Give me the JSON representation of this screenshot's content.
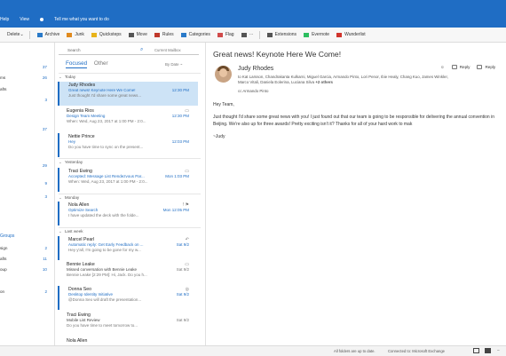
{
  "topbar": {
    "items": [
      "Help",
      "View",
      "Tell me what you want to do"
    ]
  },
  "toolbar": {
    "items": [
      {
        "label": "Delete",
        "icon": "chevron-down-icon",
        "color": "#333333"
      },
      {
        "label": "Archive",
        "icon": "archive-icon",
        "color": "#2a7ac9"
      },
      {
        "label": "Junk",
        "icon": "junk-icon",
        "color": "#e08a1e"
      },
      {
        "label": "Quicksteps",
        "icon": "lightning-icon",
        "color": "#e8b31a"
      },
      {
        "label": "Move",
        "icon": "move-icon",
        "color": "#555555"
      },
      {
        "label": "Rules",
        "icon": "rules-icon",
        "color": "#c0392b"
      },
      {
        "label": "Categories",
        "icon": "categories-icon",
        "color": "#2a7ac9"
      },
      {
        "label": "Flag",
        "icon": "flag-icon",
        "color": "#d04b4b"
      },
      {
        "label": "···",
        "icon": "more-icon",
        "color": "#555555"
      },
      {
        "label": "Extensions",
        "icon": "extensions-icon",
        "color": "#555555"
      },
      {
        "label": "Evernote",
        "icon": "evernote-icon",
        "color": "#2dbe60"
      },
      {
        "label": "Wunderlist",
        "icon": "wunderlist-icon",
        "color": "#d0342c"
      }
    ]
  },
  "left": {
    "rows": [
      {
        "label": "",
        "count": "37"
      },
      {
        "label": "ms",
        "count": "26"
      },
      {
        "label": "afts",
        "count": ""
      },
      {
        "label": "",
        "count": "3"
      },
      {
        "label": "",
        "count": "37"
      },
      {
        "label": "",
        "count": "29"
      },
      {
        "label": "",
        "count": "9"
      },
      {
        "label": "",
        "count": "3"
      }
    ],
    "groups_label": "Groups",
    "group_rows": [
      {
        "label": "sign",
        "count": "2"
      },
      {
        "label": "afts",
        "count": "11"
      },
      {
        "label": "oup",
        "count": "10"
      },
      {
        "label": "on",
        "count": "2"
      }
    ]
  },
  "list": {
    "search_placeholder": "Search",
    "search_scope": "Current Mailbox",
    "tab_focused": "Focused",
    "tab_other": "Other",
    "sort": "By Date ~",
    "groups": [
      {
        "label": "Today"
      },
      {
        "label": "Yesterday"
      },
      {
        "label": "Monday"
      },
      {
        "label": "Last week"
      }
    ],
    "messages": [
      {
        "from": "Judy Rhodes",
        "subject": "Great news! Keynote Here We Come!",
        "preview": "Just thought I'd share some great news...",
        "date": "12:30 PM",
        "icon": ""
      },
      {
        "from": "Eugenia Rios",
        "subject": "Design Team Meeting",
        "preview": "When: Wed, Aug 23, 2017 at 1:00 PM - 2:0...",
        "date": "12:30 PM",
        "icon": "▭"
      },
      {
        "from": "Nettie Prince",
        "subject": "Hey",
        "preview": "Do you have time to sync on the present...",
        "date": "12:03 PM",
        "icon": ""
      },
      {
        "from": "Traci Ewing",
        "subject": "Accepted: Message List Rendezvous Par...",
        "preview": "When: Wed, Aug 23, 2017 at 1:00 PM - 2:0...",
        "date": "Mon 1:03 PM",
        "icon": "▭"
      },
      {
        "from": "Nola Allen",
        "subject": "Optimize Search",
        "preview": "I have updated the deck with the folde...",
        "date": "Mon 12:05 PM",
        "icon": "! ⚑"
      },
      {
        "from": "Marcel Pearl",
        "subject": "Automatic reply: Get Early Feedback on ...",
        "preview": "Hey y'all, I'm going to be gone for my w...",
        "date": "Sat 9/2",
        "icon": "↶"
      },
      {
        "from": "Bennie Leake",
        "subject": "Missed conversation with Bennie Leake",
        "preview": "Bennie Leake [2:29 PM]: Hi, Jack. Do you h...",
        "date": "Sat 9/2",
        "icon": "▭"
      },
      {
        "from": "Donna Seo",
        "subject": "Desktop Identity Initiative",
        "preview": "@Donna Seo will draft the presentation...",
        "date": "Sat 9/2",
        "icon": "◎"
      },
      {
        "from": "Traci Ewing",
        "subject": "Mobile List Review",
        "preview": "Do you have time to meet tomorrow to...",
        "date": "Sat 9/2",
        "icon": ""
      },
      {
        "from": "Nola Allen",
        "subject": "",
        "preview": "",
        "date": "",
        "icon": ""
      }
    ]
  },
  "reading": {
    "title": "Great news! Keynote Here We Come!",
    "sender": "Judy Rhodes",
    "to": "Kat Larsson, Chandrakanta Kulkarni, Miguel Garcia, Armando Pinto, Lori Penor, Ibie Healy, Chang Kuo, James Winkler, Marco Vitali, Daniela Eolerina, Luciana Silva",
    "to_more": "+2 others",
    "cc": "Armando Pinto",
    "actions": [
      "Reply",
      "Reply"
    ],
    "greeting": "Hey Team,",
    "body": "Just thought I'd share some great news with you! I just found out that our team is going to be responsible for delivering the annual convention in Beijing. We're also up for three awards! Pretty exciting isn't it? Thanks for all of your hard work to mak",
    "signoff": "~Judy"
  },
  "status": {
    "left": "All folders are up to date.",
    "right": "Connected to: Microsoft Exchange"
  }
}
